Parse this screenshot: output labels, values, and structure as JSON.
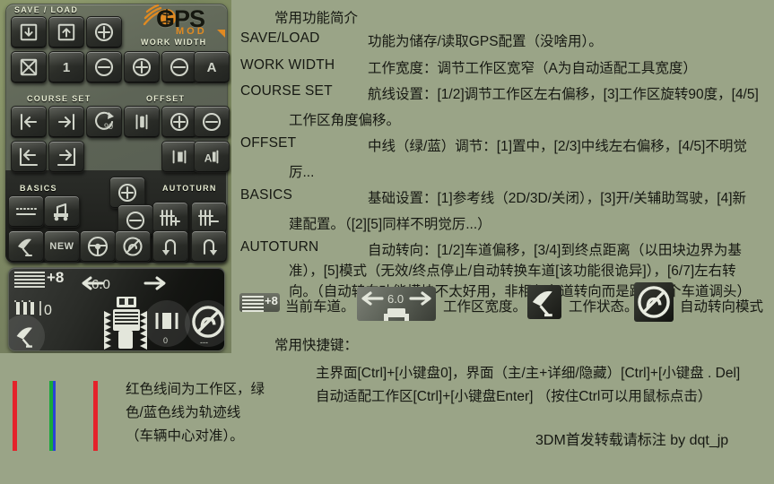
{
  "app": {
    "panel_title": "GPS",
    "panel_subtitle": "MOD"
  },
  "gps_panel": {
    "sections": [
      {
        "label": "SAVE / LOAD"
      },
      {
        "label": "WORK WIDTH"
      },
      {
        "label": "COURSE SET"
      },
      {
        "label": "OFFSET"
      },
      {
        "label": "BASICS"
      },
      {
        "label": "AUTOTURN"
      }
    ],
    "buttons": {
      "save_config": "save-config",
      "load_config": "load-config",
      "slot_add": "plus",
      "delete_config": "delete",
      "slot_number": "1",
      "slot_remove": "minus",
      "width_plus": "plus",
      "width_minus": "minus",
      "width_auto": "A",
      "course_left": "shift-left",
      "course_right": "shift-right",
      "course_rotate": "90",
      "course_snap_left": "snap-left",
      "course_snap_right": "snap-right",
      "offset_center": "center",
      "offset_plus": "plus",
      "offset_minus": "minus",
      "offset_lr": "left-right",
      "offset_auto": "A",
      "basics_refline": "reference-line",
      "basics_toolcfg": "tool-config",
      "basics_gps": "gps-toggle",
      "basics_new": "NEW",
      "basics_steer": "assisted-steering",
      "autoturn_plus": "lane-plus",
      "autoturn_minus": "lane-minus",
      "autoturn_off": "disabled",
      "autoturn_left": "turn-left",
      "autoturn_right": "turn-right",
      "zoom_plus": "plus",
      "zoom_minus": "minus"
    },
    "display": {
      "lane_value": "+8",
      "tool_value": "0",
      "work_width": "6.0",
      "hitch_value": "0",
      "autoturn_value": "---"
    }
  },
  "content": {
    "heading": "常用功能简介",
    "entries": [
      {
        "term": "SAVE/LOAD",
        "lines": [
          "功能为储存/读取GPS配置（没啥用）。"
        ]
      },
      {
        "term": "WORK WIDTH",
        "lines": [
          "工作宽度：调节工作区宽窄（A为自动适配工具宽度）"
        ]
      },
      {
        "term": "COURSE SET",
        "lines": [
          "航线设置：[1/2]调节工作区左右偏移，[3]工作区旋转90度，[4/5]",
          "工作区角度偏移。"
        ]
      },
      {
        "term": "OFFSET",
        "lines": [
          "中线（绿/蓝）调节：[1]置中，[2/3]中线左右偏移，[4/5]不明觉",
          "厉..."
        ]
      },
      {
        "term": "BASICS",
        "lines": [
          "基础设置：[1]参考线（2D/3D/关闭），[3]开/关辅助驾驶，[4]新",
          "建配置。（[2][5]同样不明觉厉...）"
        ]
      },
      {
        "term": "AUTOTURN",
        "lines": [
          "自动转向：[1/2]车道偏移，[3/4]到终点距离（以田块边界为基",
          "准），[5]模式（无效/终点停止/自动转换车道[该功能很诡异]），[6/7]左右转",
          "向。（自动转向功能模块不太好用，非相邻车道转向而是跳过N个车道调头）"
        ]
      }
    ],
    "icon_legend": [
      {
        "icon": "lane-indicator-icon",
        "value": "+8",
        "label": "当前车道。"
      },
      {
        "icon": "work-width-icon",
        "value": "6.0",
        "label": "工作区宽度。"
      },
      {
        "icon": "gps-status-icon",
        "label": "工作状态。"
      },
      {
        "icon": "autoturn-mode-icon",
        "label": "自动转向模式"
      }
    ],
    "shortcuts": {
      "heading": "常用快捷键：",
      "lines": [
        "主界面[Ctrl]+[小键盘0]，界面（主/主+详细/隐藏）[Ctrl]+[小键盘 . Del]",
        "自动适配工作区[Ctrl]+[小键盘Enter]        （按住Ctrl可以用鼠标点击）"
      ]
    },
    "credit": "3DM首发转载请标注 by dqt_jp"
  },
  "legend": {
    "lines": [
      "红色线间为工作区，绿",
      "色/蓝色线为轨迹线",
      "（车辆中心对准）。"
    ],
    "colors": {
      "work_boundary": "#e4222b",
      "track_green": "#1aa83c",
      "track_blue": "#2a43d8"
    }
  }
}
